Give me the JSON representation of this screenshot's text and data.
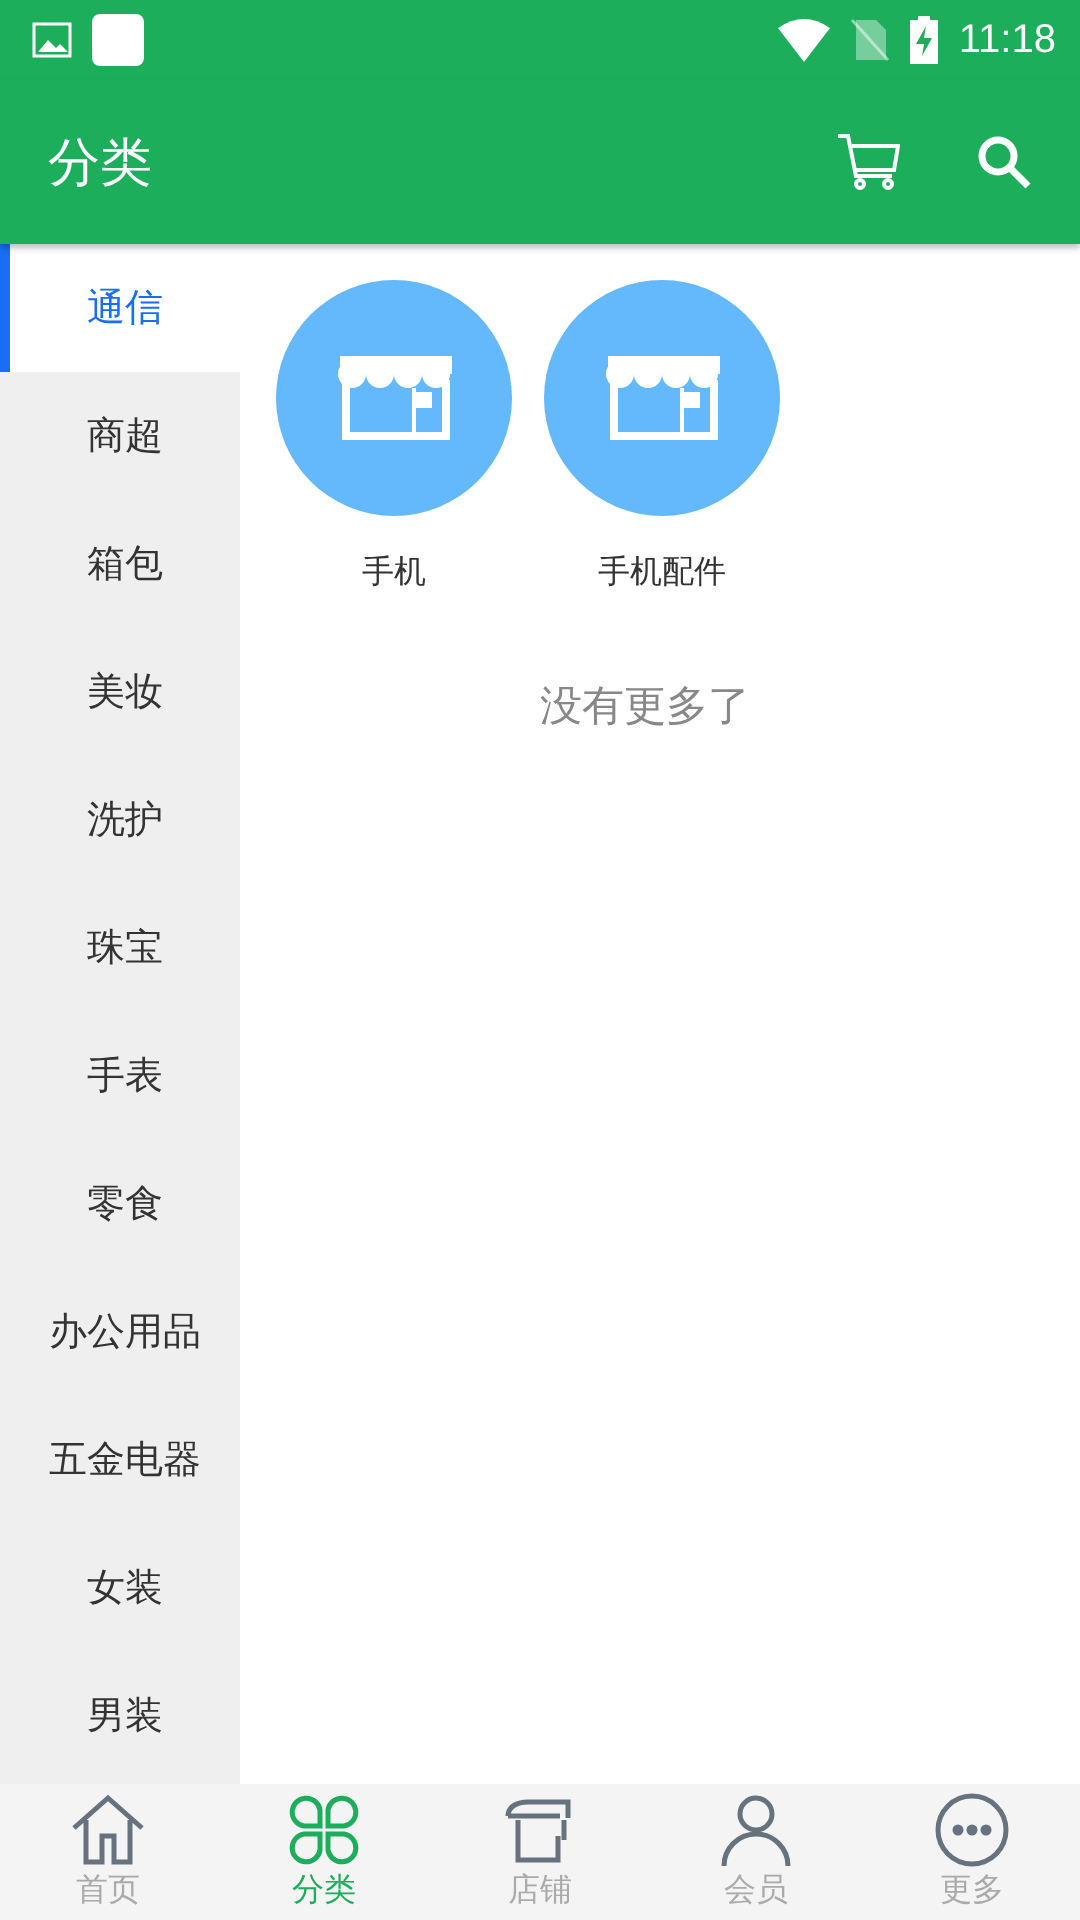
{
  "status_bar": {
    "time": "11:18"
  },
  "app_bar": {
    "title": "分类"
  },
  "sidebar": {
    "items": [
      {
        "label": "通信",
        "selected": true
      },
      {
        "label": "商超",
        "selected": false
      },
      {
        "label": "箱包",
        "selected": false
      },
      {
        "label": "美妆",
        "selected": false
      },
      {
        "label": "洗护",
        "selected": false
      },
      {
        "label": "珠宝",
        "selected": false
      },
      {
        "label": "手表",
        "selected": false
      },
      {
        "label": "零食",
        "selected": false
      },
      {
        "label": "办公用品",
        "selected": false
      },
      {
        "label": "五金电器",
        "selected": false
      },
      {
        "label": "女装",
        "selected": false
      },
      {
        "label": "男装",
        "selected": false
      }
    ]
  },
  "categories": [
    {
      "label": "手机"
    },
    {
      "label": "手机配件"
    }
  ],
  "end_message": "没有更多了",
  "tab_bar": [
    {
      "kind": "home",
      "label": "首页",
      "selected": false
    },
    {
      "kind": "category",
      "label": "分类",
      "selected": true
    },
    {
      "kind": "store",
      "label": "店铺",
      "selected": false
    },
    {
      "kind": "member",
      "label": "会员",
      "selected": false
    },
    {
      "kind": "more",
      "label": "更多",
      "selected": false
    }
  ]
}
